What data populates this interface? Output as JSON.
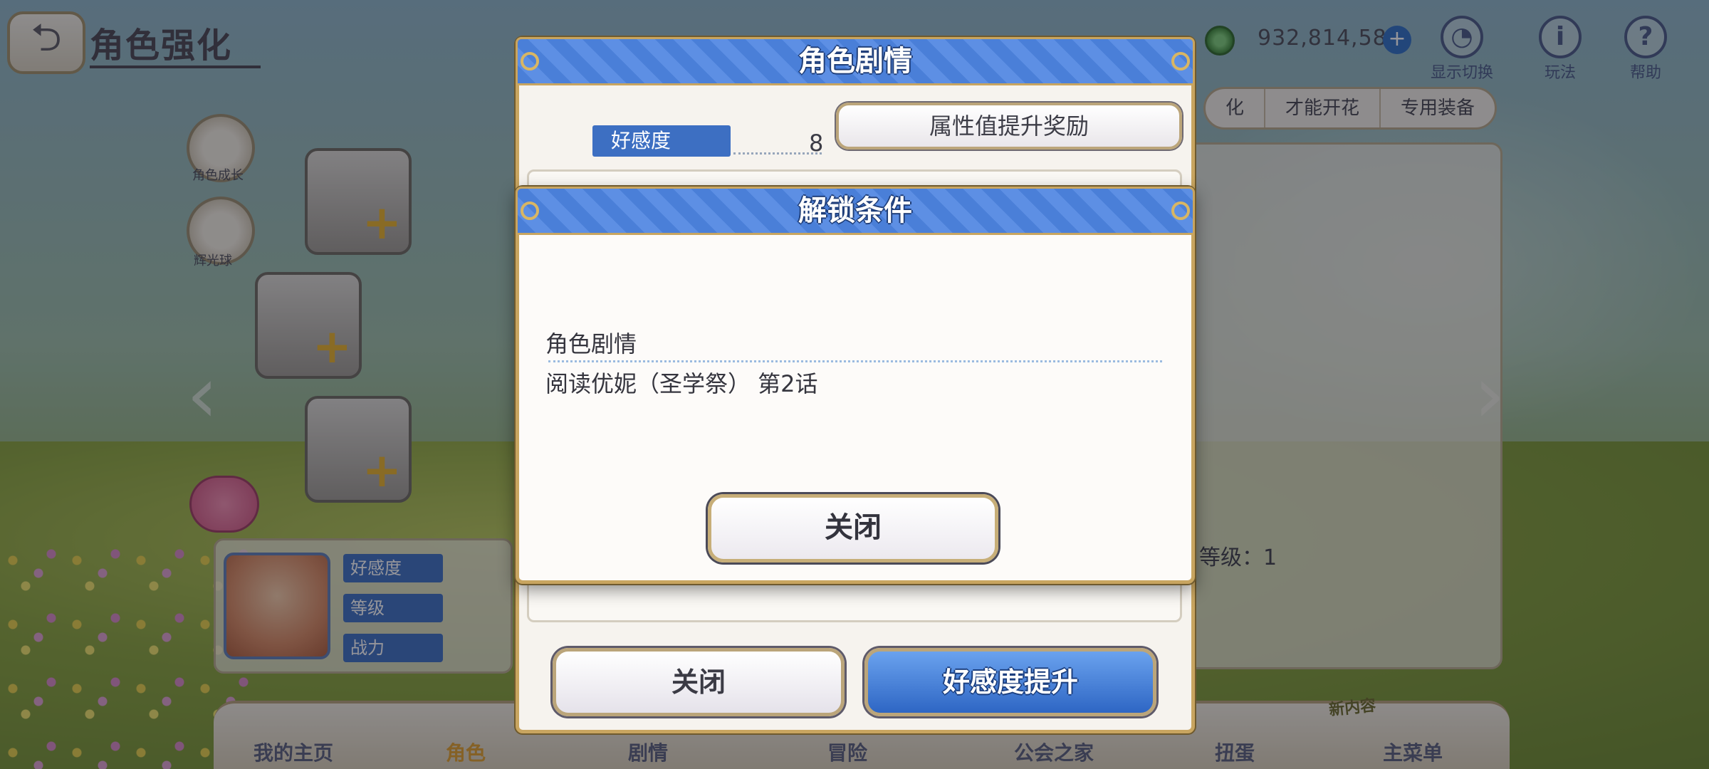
{
  "header": {
    "back_icon": "back-arrow-icon",
    "title": "角色强化"
  },
  "currency": {
    "icon": "coin-icon",
    "value": "932,814,588",
    "plus": "+"
  },
  "top_tools": [
    {
      "icon": "display-switch-icon",
      "glyph": "◔",
      "label": "显示切换"
    },
    {
      "icon": "info-icon",
      "glyph": "i",
      "label": "玩法"
    },
    {
      "icon": "help-icon",
      "glyph": "?",
      "label": "帮助"
    }
  ],
  "side_buttons": [
    {
      "label": "角色成长"
    },
    {
      "label": "辉光球"
    }
  ],
  "right_tabs": [
    "化",
    "才能开花",
    "专用装备"
  ],
  "level_text": "等级：1",
  "stats": [
    "好感度",
    "等级",
    "战力"
  ],
  "bottom_nav": {
    "items": [
      "我的主页",
      "角色",
      "剧情",
      "冒险",
      "公会之家",
      "扭蛋",
      "主菜单"
    ],
    "active_index": 1,
    "new_badge": "新内容"
  },
  "story_dialog": {
    "title": "角色剧情",
    "affection_label": "好感度",
    "affection_value": "8",
    "reward_button": "属性值提升奖励",
    "close_button": "关闭",
    "raise_button": "好感度提升"
  },
  "unlock_dialog": {
    "title": "解锁条件",
    "condition_label": "角色剧情",
    "condition_text": "阅读优妮（圣学祭） 第2话",
    "close_button": "关闭"
  },
  "colors": {
    "header_blue": "#4a7fd8",
    "gold_border": "#c8a560",
    "label_blue": "#3d6fc2",
    "active_nav": "#e2a12c"
  }
}
